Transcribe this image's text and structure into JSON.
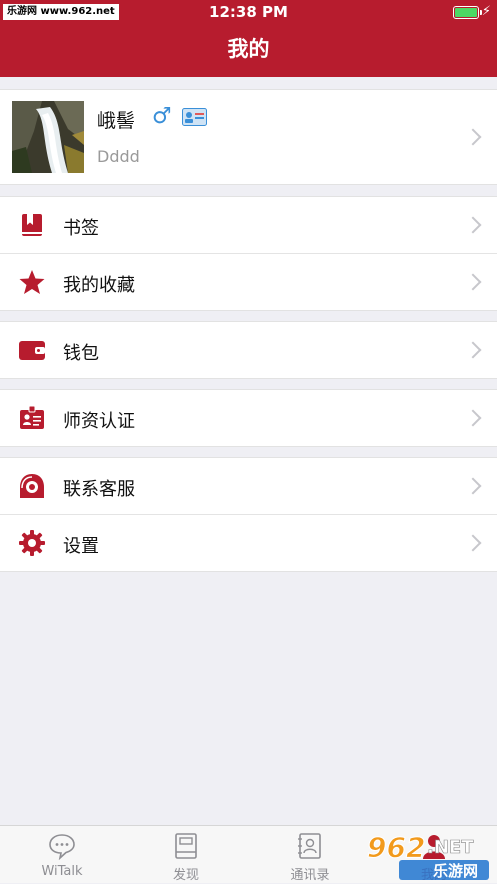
{
  "status_bar": {
    "watermark": "乐游网 www.962.net",
    "time": "12:38 PM"
  },
  "nav": {
    "title": "我的"
  },
  "profile": {
    "name": "峨髻",
    "gender_symbol": "♂",
    "user_id": "Dddd"
  },
  "menu": {
    "bookmark": "书签",
    "favorites": "我的收藏",
    "wallet": "钱包",
    "teacher_verify": "师资认证",
    "contact_service": "联系客服",
    "settings": "设置"
  },
  "tabs": {
    "witalk": "WiTalk",
    "discover": "发现",
    "contacts": "通讯录",
    "mine": "我的"
  },
  "watermark_logo": {
    "number": "962",
    "suffix": ".NET",
    "cn": "乐游网"
  },
  "colors": {
    "brand": "#b71c2e",
    "background": "#efeff4",
    "tab_inactive": "#8e8e93"
  }
}
